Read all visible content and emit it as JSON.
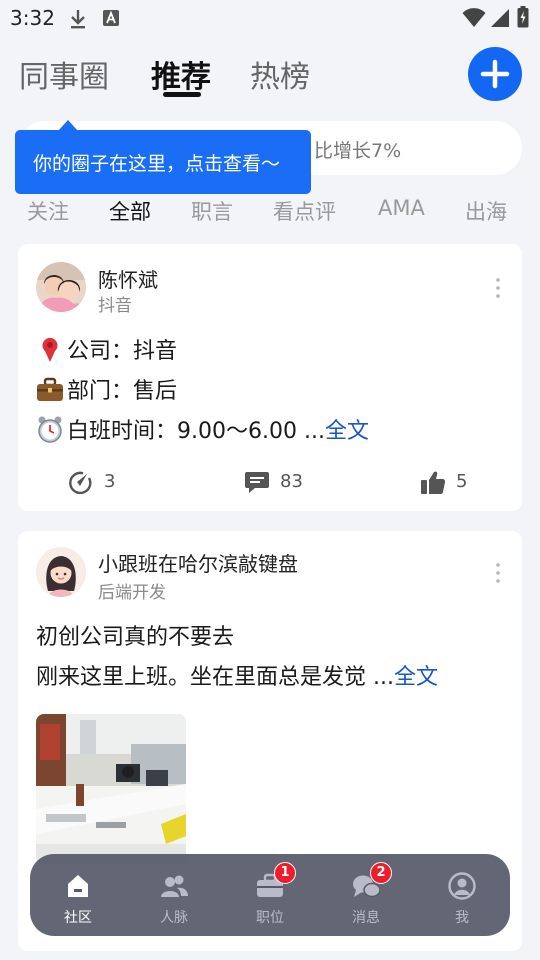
{
  "status_bar": {
    "time": "3:32",
    "icons": [
      "download-icon",
      "font-a-icon",
      "wifi-icon",
      "signal-icon",
      "battery-charging-icon"
    ]
  },
  "header": {
    "tabs": [
      {
        "label": "同事圈",
        "active": false
      },
      {
        "label": "推荐",
        "active": true
      },
      {
        "label": "热榜",
        "active": false
      }
    ],
    "add_button_icon": "plus-icon"
  },
  "search": {
    "visible_text": "比增长7%"
  },
  "tooltip": {
    "text": "你的圈子在这里，点击查看～"
  },
  "categories": [
    {
      "label": "关注",
      "active": false
    },
    {
      "label": "全部",
      "active": true
    },
    {
      "label": "职言",
      "active": false
    },
    {
      "label": "看点评",
      "active": false
    },
    {
      "label": "AMA",
      "active": false
    },
    {
      "label": "出海",
      "active": false
    }
  ],
  "posts": [
    {
      "author": "陈怀斌",
      "dept": "抖音",
      "lines": [
        {
          "emoji": "pin-icon",
          "text": "公司：抖音"
        },
        {
          "emoji": "briefcase-icon",
          "text": "部门：售后"
        },
        {
          "emoji": "alarm-clock-icon",
          "text": "白班时间：9.00～6.00 ...",
          "more": "全文"
        }
      ],
      "stats": {
        "views": "3",
        "comments": "83",
        "likes": "5"
      }
    },
    {
      "author": "小跟班在哈尔滨敲键盘",
      "dept": "后端开发",
      "lines": [
        {
          "text": "初创公司真的不要去"
        },
        {
          "text": "刚来这里上班。坐在里面总是发觉 ...",
          "more": "全文"
        }
      ]
    }
  ],
  "bottom_nav": [
    {
      "label": "社区",
      "icon": "home-icon",
      "active": true
    },
    {
      "label": "人脉",
      "icon": "contacts-icon",
      "active": false
    },
    {
      "label": "职位",
      "icon": "briefcase-icon",
      "active": false,
      "badge": "1"
    },
    {
      "label": "消息",
      "icon": "chat-icon",
      "active": false,
      "badge": "2"
    },
    {
      "label": "我",
      "icon": "profile-icon",
      "active": false
    }
  ],
  "colors": {
    "accent": "#1268f2",
    "link": "#1a56c8",
    "badge": "#ee1d2c",
    "background": "#f3f4f7"
  }
}
